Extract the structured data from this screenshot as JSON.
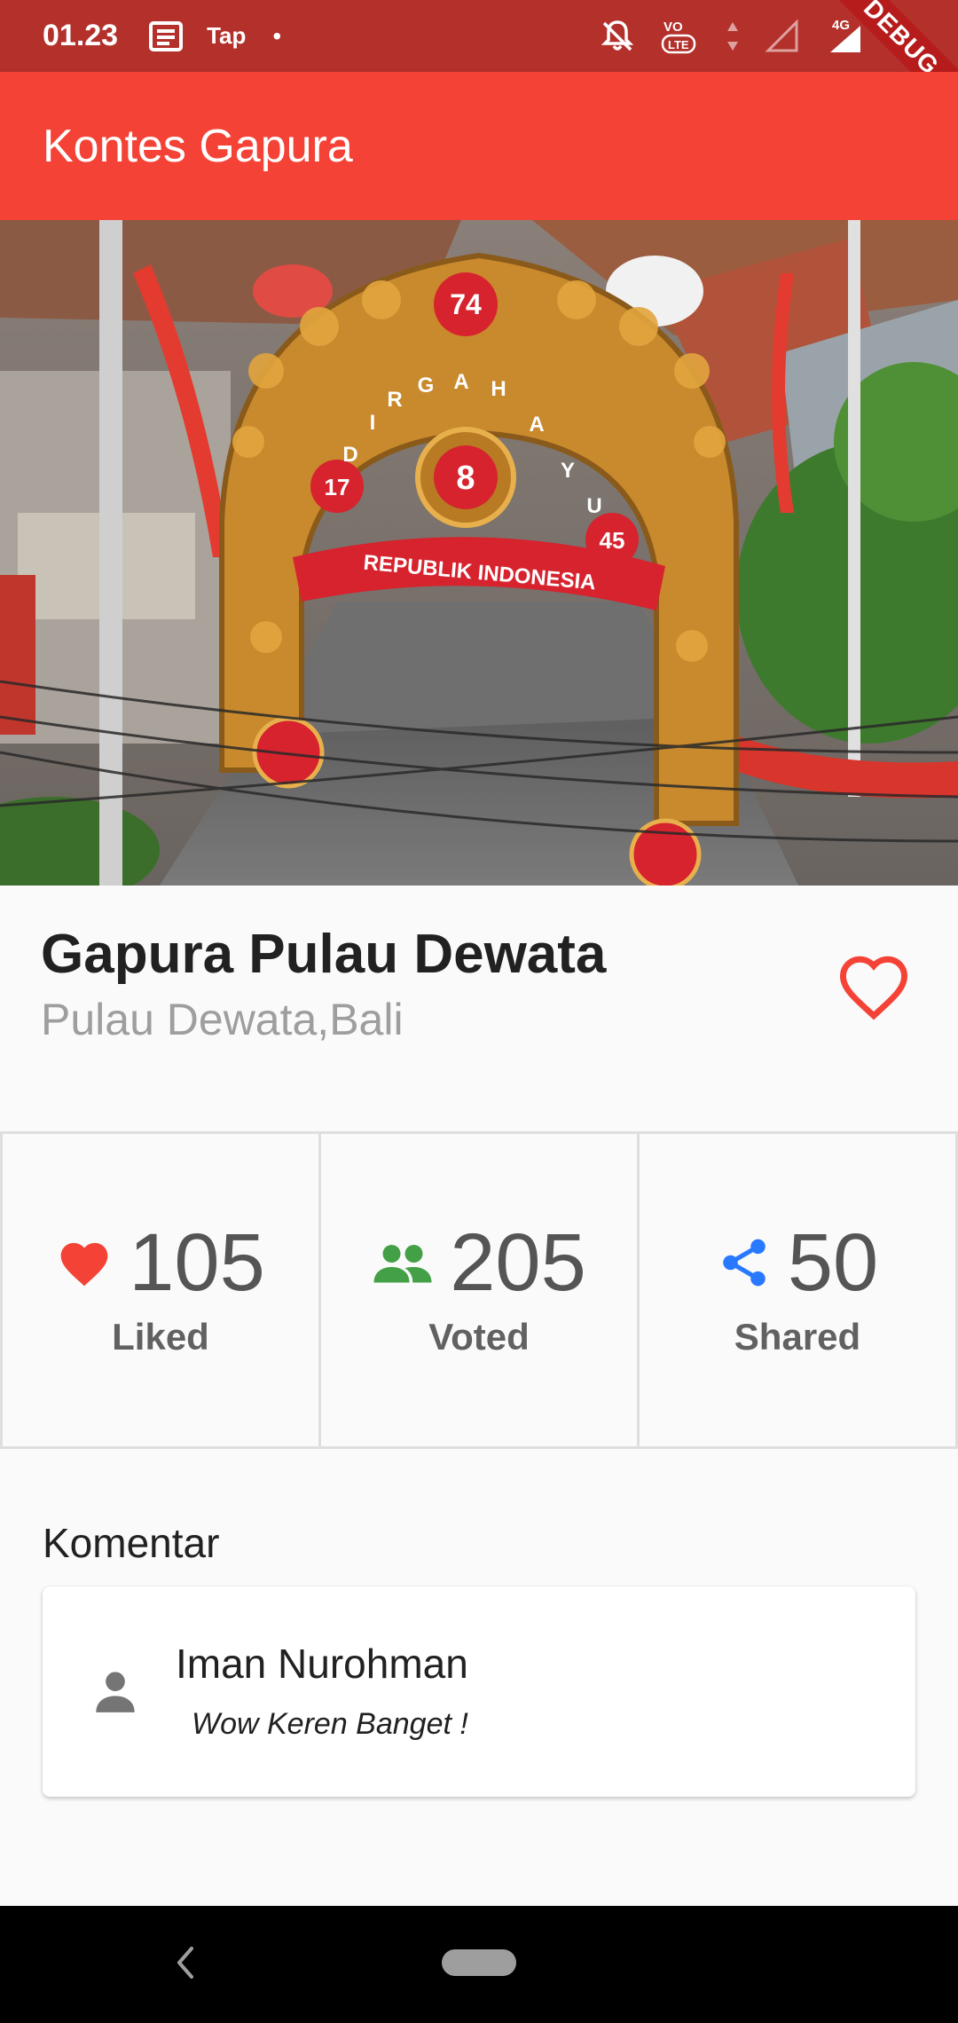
{
  "status_bar": {
    "time": "01.23",
    "app_label": "Tap",
    "dot": "•",
    "network": "4G",
    "debug_banner": "DEBUG",
    "background": "#b3302b"
  },
  "app_bar": {
    "title": "Kontes Gapura",
    "background": "#f44336"
  },
  "hero": {
    "arch_texts": [
      "74",
      "D",
      "I",
      "R",
      "G",
      "A",
      "H",
      "A",
      "Y",
      "U",
      "17",
      "8",
      "45",
      "REPUBLIK INDONESIA"
    ]
  },
  "place": {
    "title": "Gapura Pulau Dewata",
    "subtitle": "Pulau Dewata,Bali",
    "favorite_icon": "heart-outline-icon"
  },
  "stats": [
    {
      "icon": "heart-icon",
      "icon_color": "#f44336",
      "value": "105",
      "label": "Liked"
    },
    {
      "icon": "people-icon",
      "icon_color": "#43a047",
      "value": "205",
      "label": "Voted"
    },
    {
      "icon": "share-icon",
      "icon_color": "#2979ff",
      "value": "50",
      "label": "Shared"
    }
  ],
  "comments": {
    "heading": "Komentar",
    "items": [
      {
        "author": "Iman Nurohman",
        "text": "Wow Keren Banget !",
        "avatar_icon": "person-icon"
      }
    ]
  }
}
